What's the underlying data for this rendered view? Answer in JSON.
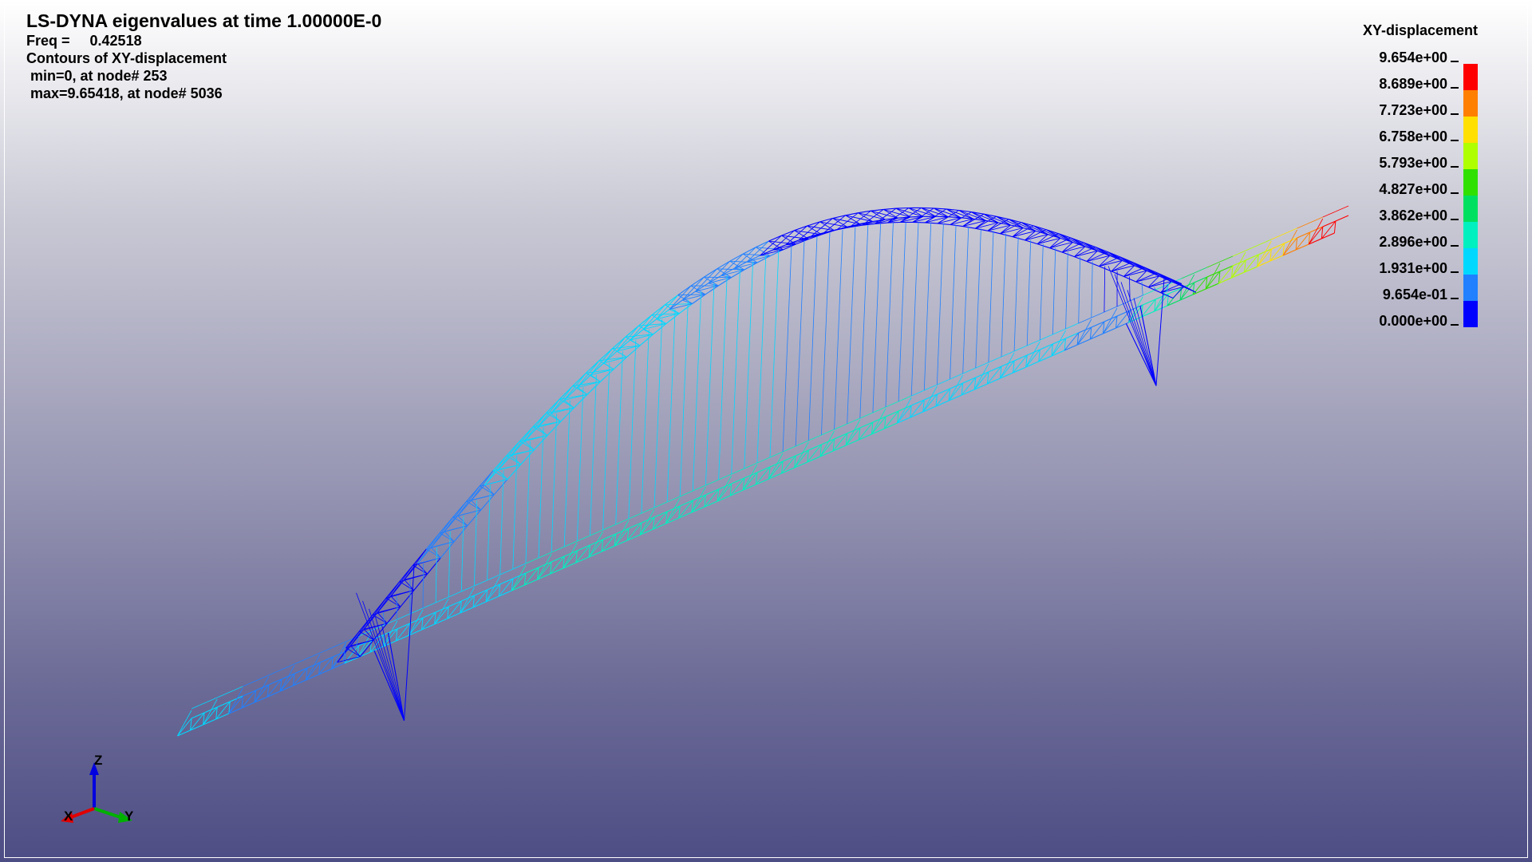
{
  "header": {
    "title": "LS-DYNA eigenvalues at time  1.00000E-0",
    "freq_line": "Freq =     0.42518",
    "contour_line": "Contours of XY-displacement",
    "min_line": " min=0, at node# 253",
    "max_line": " max=9.65418, at node# 5036"
  },
  "legend": {
    "title": "XY-displacement",
    "values": [
      "9.654e+00",
      "8.689e+00",
      "7.723e+00",
      "6.758e+00",
      "5.793e+00",
      "4.827e+00",
      "3.862e+00",
      "2.896e+00",
      "1.931e+00",
      "9.654e-01",
      "0.000e+00"
    ],
    "colors": [
      "#ff0000",
      "#ff7f00",
      "#ffe000",
      "#b0ff00",
      "#30e000",
      "#00e060",
      "#00f0c0",
      "#00d8ff",
      "#2080ff",
      "#0000ff"
    ]
  },
  "triad": {
    "x": "X",
    "y": "Y",
    "z": "Z",
    "x_color": "#e00000",
    "y_color": "#00b000",
    "z_color": "#0000e0"
  }
}
